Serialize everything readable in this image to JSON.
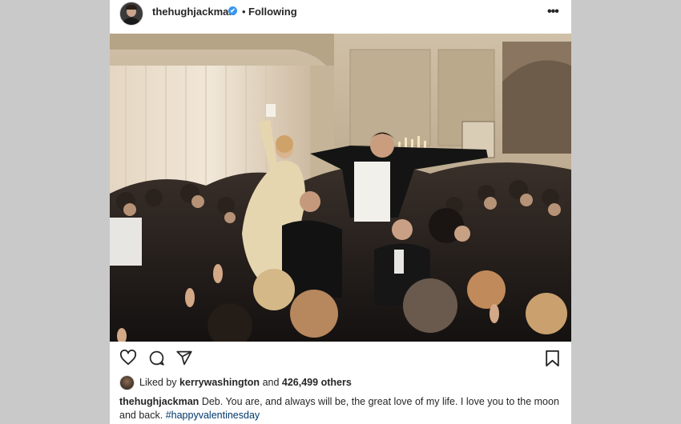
{
  "header": {
    "username": "thehughjackman",
    "verified_mark": "✔",
    "separator": "•",
    "follow_status": "Following",
    "more_label": "•••"
  },
  "photo": {
    "icon": "wedding-photo"
  },
  "actions": {
    "icons": [
      "heart-icon",
      "comment-icon",
      "share-icon",
      "bookmark-icon"
    ]
  },
  "likes": {
    "prefix": "Liked by",
    "user": "kerrywashington",
    "connector": "and",
    "count": "426,499 others"
  },
  "caption": {
    "user": "thehughjackman",
    "text": "Deb. You are, and always will be, the great love of my life. I love you to the moon and back.",
    "hashtag": "#happyvalentinesday"
  },
  "colors": {
    "background": "#c9c9c9",
    "card": "#ffffff",
    "text": "#262626",
    "verified": "#3897f0",
    "hashtag": "#00376b"
  }
}
